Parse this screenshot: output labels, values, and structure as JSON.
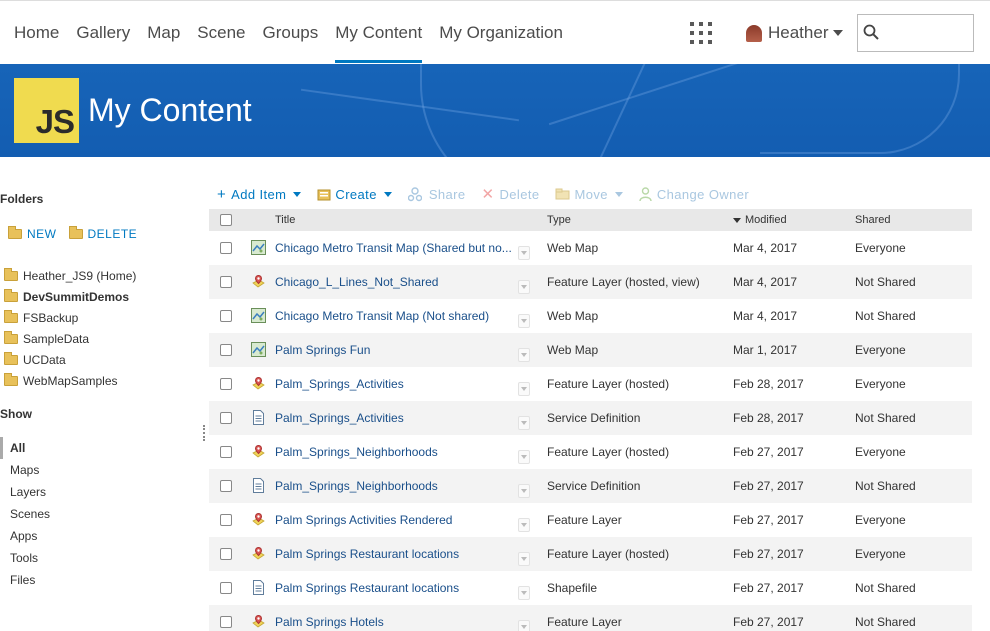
{
  "nav": {
    "links": [
      "Home",
      "Gallery",
      "Map",
      "Scene",
      "Groups",
      "My Content",
      "My Organization"
    ],
    "active": "My Content",
    "user_name": "Heather",
    "search_placeholder": ""
  },
  "banner": {
    "logo_text": "JS",
    "title": "My Content"
  },
  "sidebar": {
    "folders_heading": "Folders",
    "new_label": "NEW",
    "delete_label": "DELETE",
    "folders": [
      "Heather_JS9 (Home)",
      "DevSummitDemos",
      "FSBackup",
      "SampleData",
      "UCData",
      "WebMapSamples"
    ],
    "active_folder": "DevSummitDemos",
    "show_heading": "Show",
    "show_items": [
      "All",
      "Maps",
      "Layers",
      "Scenes",
      "Apps",
      "Tools",
      "Files"
    ],
    "active_show": "All"
  },
  "toolbar": {
    "add_item": "Add Item",
    "create": "Create",
    "share": "Share",
    "delete": "Delete",
    "move": "Move",
    "change_owner": "Change Owner"
  },
  "table": {
    "headers": {
      "title": "Title",
      "type": "Type",
      "modified": "Modified",
      "shared": "Shared"
    },
    "rows": [
      {
        "icon": "webmap",
        "title": "Chicago Metro Transit Map (Shared but no...",
        "type": "Web Map",
        "modified": "Mar 4, 2017",
        "shared": "Everyone"
      },
      {
        "icon": "feature",
        "title": "Chicago_L_Lines_Not_Shared",
        "type": "Feature Layer (hosted, view)",
        "modified": "Mar 4, 2017",
        "shared": "Not Shared"
      },
      {
        "icon": "webmap",
        "title": "Chicago Metro Transit Map (Not shared)",
        "type": "Web Map",
        "modified": "Mar 4, 2017",
        "shared": "Not Shared"
      },
      {
        "icon": "webmap",
        "title": "Palm Springs Fun",
        "type": "Web Map",
        "modified": "Mar 1, 2017",
        "shared": "Everyone"
      },
      {
        "icon": "feature",
        "title": "Palm_Springs_Activities",
        "type": "Feature Layer (hosted)",
        "modified": "Feb 28, 2017",
        "shared": "Everyone"
      },
      {
        "icon": "document",
        "title": "Palm_Springs_Activities",
        "type": "Service Definition",
        "modified": "Feb 28, 2017",
        "shared": "Not Shared"
      },
      {
        "icon": "feature",
        "title": "Palm_Springs_Neighborhoods",
        "type": "Feature Layer (hosted)",
        "modified": "Feb 27, 2017",
        "shared": "Everyone"
      },
      {
        "icon": "document",
        "title": "Palm_Springs_Neighborhoods",
        "type": "Service Definition",
        "modified": "Feb 27, 2017",
        "shared": "Not Shared"
      },
      {
        "icon": "feature",
        "title": "Palm Springs Activities Rendered",
        "type": "Feature Layer",
        "modified": "Feb 27, 2017",
        "shared": "Everyone"
      },
      {
        "icon": "feature",
        "title": "Palm Springs Restaurant locations",
        "type": "Feature Layer (hosted)",
        "modified": "Feb 27, 2017",
        "shared": "Everyone"
      },
      {
        "icon": "document",
        "title": "Palm Springs Restaurant locations",
        "type": "Shapefile",
        "modified": "Feb 27, 2017",
        "shared": "Not Shared"
      },
      {
        "icon": "feature",
        "title": "Palm Springs Hotels",
        "type": "Feature Layer",
        "modified": "Feb 27, 2017",
        "shared": "Not Shared"
      }
    ]
  },
  "colors": {
    "accent": "#0079c1",
    "banner": "#1764b8",
    "logo": "#f0db4f",
    "link": "#1a4f8a"
  }
}
